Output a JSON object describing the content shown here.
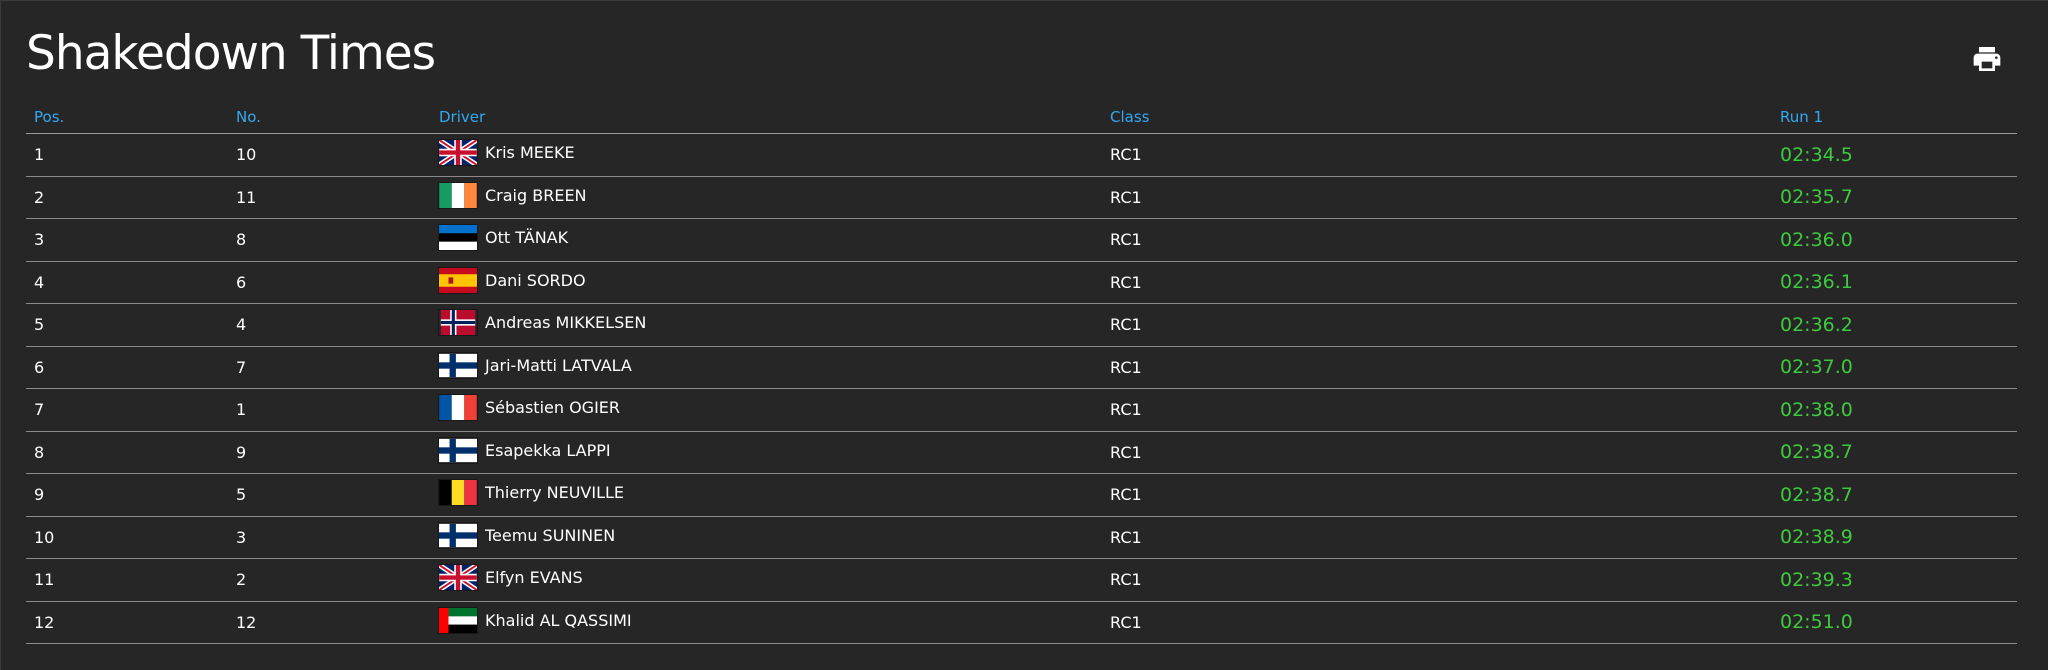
{
  "page": {
    "title": "Shakedown Times",
    "print_icon": "print-icon"
  },
  "colors": {
    "background": "#262626",
    "header_text": "#33a8f0",
    "time_text": "#3fc93f",
    "row_text": "#ffffff",
    "divider": "#8a8a8a"
  },
  "table": {
    "headers": {
      "pos": "Pos.",
      "no": "No.",
      "driver": "Driver",
      "class": "Class",
      "run1": "Run 1"
    },
    "rows": [
      {
        "pos": "1",
        "no": "10",
        "flag": "gb",
        "driver": "Kris MEEKE",
        "class": "RC1",
        "run1": "02:34.5"
      },
      {
        "pos": "2",
        "no": "11",
        "flag": "ie",
        "driver": "Craig BREEN",
        "class": "RC1",
        "run1": "02:35.7"
      },
      {
        "pos": "3",
        "no": "8",
        "flag": "ee",
        "driver": "Ott TÄNAK",
        "class": "RC1",
        "run1": "02:36.0"
      },
      {
        "pos": "4",
        "no": "6",
        "flag": "es",
        "driver": "Dani SORDO",
        "class": "RC1",
        "run1": "02:36.1"
      },
      {
        "pos": "5",
        "no": "4",
        "flag": "no",
        "driver": "Andreas MIKKELSEN",
        "class": "RC1",
        "run1": "02:36.2"
      },
      {
        "pos": "6",
        "no": "7",
        "flag": "fi",
        "driver": "Jari-Matti LATVALA",
        "class": "RC1",
        "run1": "02:37.0"
      },
      {
        "pos": "7",
        "no": "1",
        "flag": "fr",
        "driver": "Sébastien OGIER",
        "class": "RC1",
        "run1": "02:38.0"
      },
      {
        "pos": "8",
        "no": "9",
        "flag": "fi",
        "driver": "Esapekka LAPPI",
        "class": "RC1",
        "run1": "02:38.7"
      },
      {
        "pos": "9",
        "no": "5",
        "flag": "be",
        "driver": "Thierry NEUVILLE",
        "class": "RC1",
        "run1": "02:38.7"
      },
      {
        "pos": "10",
        "no": "3",
        "flag": "fi",
        "driver": "Teemu SUNINEN",
        "class": "RC1",
        "run1": "02:38.9"
      },
      {
        "pos": "11",
        "no": "2",
        "flag": "gb",
        "driver": "Elfyn EVANS",
        "class": "RC1",
        "run1": "02:39.3"
      },
      {
        "pos": "12",
        "no": "12",
        "flag": "ae",
        "driver": "Khalid AL QASSIMI",
        "class": "RC1",
        "run1": "02:51.0"
      }
    ]
  }
}
